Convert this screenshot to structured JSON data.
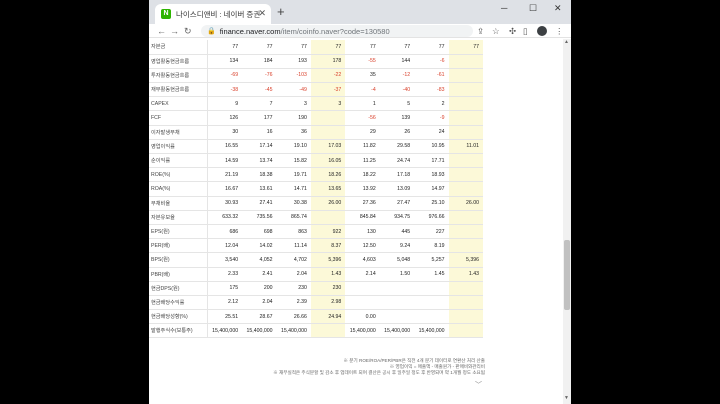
{
  "tab": {
    "title": "나이스디앤비 : 네이버 증권",
    "favicon": "N"
  },
  "window_controls": {
    "minimize": "─",
    "maximize": "☐",
    "close": "✕"
  },
  "url": {
    "host": "finance.naver.com",
    "path": "/item/coinfo.naver?code=130580"
  },
  "rows": [
    {
      "label": "자본금",
      "cells": [
        "77",
        "77",
        "77",
        "77",
        "77",
        "77",
        "77",
        "77"
      ]
    },
    {
      "label": "영업활동현금흐름",
      "cells": [
        "134",
        "184",
        "193",
        "178",
        "-55",
        "144",
        "-6",
        ""
      ]
    },
    {
      "label": "투자활동현금흐름",
      "cells": [
        "-69",
        "-76",
        "-103",
        "-22",
        "35",
        "-12",
        "-61",
        ""
      ]
    },
    {
      "label": "재무활동현금흐름",
      "cells": [
        "-38",
        "-45",
        "-49",
        "-37",
        "-4",
        "-40",
        "-83",
        ""
      ]
    },
    {
      "label": "CAPEX",
      "cells": [
        "9",
        "7",
        "3",
        "3",
        "1",
        "5",
        "2",
        ""
      ]
    },
    {
      "label": "FCF",
      "cells": [
        "126",
        "177",
        "190",
        "",
        "-56",
        "139",
        "-9",
        ""
      ]
    },
    {
      "label": "이자발생부채",
      "cells": [
        "30",
        "16",
        "36",
        "",
        "29",
        "26",
        "24",
        ""
      ]
    },
    {
      "label": "영업이익률",
      "cells": [
        "16.55",
        "17.14",
        "19.10",
        "17.03",
        "11.82",
        "29.58",
        "10.95",
        "11.01"
      ]
    },
    {
      "label": "순이익률",
      "cells": [
        "14.59",
        "13.74",
        "15.82",
        "16.05",
        "11.25",
        "24.74",
        "17.71",
        ""
      ]
    },
    {
      "label": "ROE(%)",
      "cells": [
        "21.19",
        "18.38",
        "19.71",
        "18.26",
        "18.22",
        "17.18",
        "18.93",
        ""
      ]
    },
    {
      "label": "ROA(%)",
      "cells": [
        "16.67",
        "13.61",
        "14.71",
        "13.65",
        "13.92",
        "13.09",
        "14.97",
        ""
      ]
    },
    {
      "label": "부채비율",
      "cells": [
        "30.93",
        "27.41",
        "30.38",
        "26.00",
        "27.36",
        "27.47",
        "25.10",
        "26.00"
      ]
    },
    {
      "label": "자본유보율",
      "cells": [
        "633.32",
        "735.56",
        "865.74",
        "",
        "845.84",
        "934.75",
        "976.66",
        ""
      ]
    },
    {
      "label": "EPS(원)",
      "cells": [
        "686",
        "698",
        "863",
        "922",
        "130",
        "445",
        "227",
        ""
      ]
    },
    {
      "label": "PER(배)",
      "cells": [
        "12.04",
        "14.02",
        "11.14",
        "8.37",
        "12.50",
        "9.24",
        "8.19",
        ""
      ]
    },
    {
      "label": "BPS(원)",
      "cells": [
        "3,540",
        "4,052",
        "4,702",
        "5,396",
        "4,603",
        "5,048",
        "5,257",
        "5,396"
      ]
    },
    {
      "label": "PBR(배)",
      "cells": [
        "2.33",
        "2.41",
        "2.04",
        "1.43",
        "2.14",
        "1.50",
        "1.45",
        "1.43"
      ]
    },
    {
      "label": "현금DPS(원)",
      "cells": [
        "175",
        "200",
        "230",
        "230",
        "",
        "",
        "",
        ""
      ]
    },
    {
      "label": "현금배당수익률",
      "cells": [
        "2.12",
        "2.04",
        "2.39",
        "2.98",
        "",
        "",
        "",
        ""
      ]
    },
    {
      "label": "현금배당성향(%)",
      "cells": [
        "25.51",
        "28.67",
        "26.66",
        "24.94",
        "0.00",
        "",
        "",
        ""
      ]
    },
    {
      "label": "발행주식수(보통주)",
      "cells": [
        "15,400,000",
        "15,400,000",
        "15,400,000",
        "",
        "15,400,000",
        "15,400,000",
        "15,400,000",
        ""
      ]
    }
  ],
  "estimate_columns": [
    3,
    7
  ],
  "footnotes": [
    "※ 분기 ROE/ROA/PER/PBR은 직전 4개 분기 데이터로 연환산 처리 산출",
    "※ 영업이익 = 매출액 - 매출원가 - 판매비와관리비",
    "※ 재무실적은 주식분할 및 감소 후 업데이트 되며 결산은 공시 후 일주일 정도 후 반영되며 약 1개월 정도 소요됨"
  ]
}
